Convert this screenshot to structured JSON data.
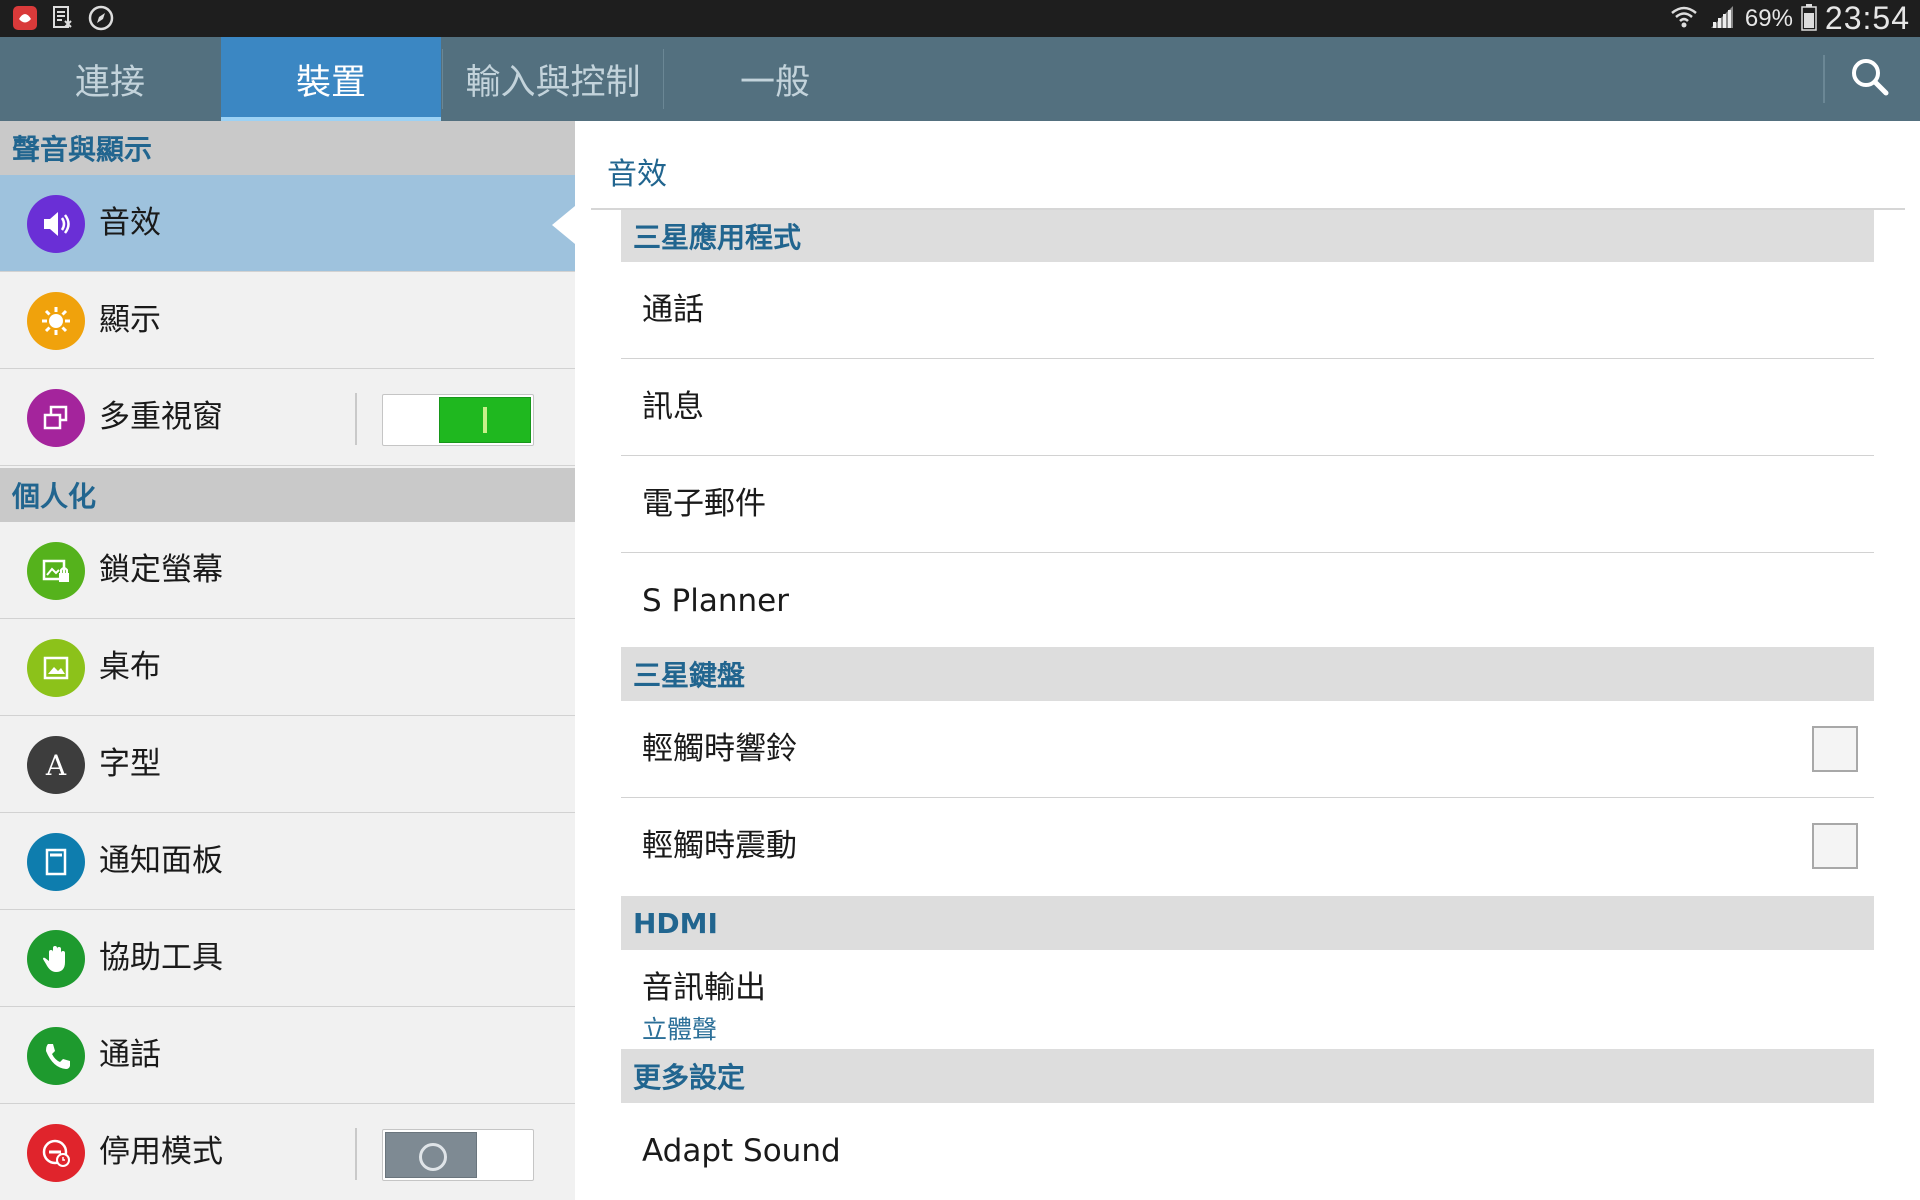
{
  "status_bar": {
    "left_icons": [
      "app-notification-icon",
      "document-icon",
      "compass-icon"
    ],
    "right_icons": [
      "wifi-icon",
      "signal-icon",
      "battery-icon"
    ],
    "battery": "69%",
    "time": "23:54"
  },
  "tabs": [
    {
      "label": "連接",
      "active": false
    },
    {
      "label": "裝置",
      "active": true
    },
    {
      "label": "輸入與控制",
      "active": false
    },
    {
      "label": "一般",
      "active": false
    }
  ],
  "search_icon": "search-icon",
  "left": {
    "sections": [
      {
        "header": "聲音與顯示",
        "items": [
          {
            "label": "音效",
            "icon": "speaker-icon",
            "color": "#6a2fd6",
            "selected": true
          },
          {
            "label": "顯示",
            "icon": "brightness-icon",
            "color": "#f0a20c"
          },
          {
            "label": "多重視窗",
            "icon": "multi-window-icon",
            "color": "#a4249c",
            "switch": "on"
          }
        ]
      },
      {
        "header": "個人化",
        "items": [
          {
            "label": "鎖定螢幕",
            "icon": "lock-screen-icon",
            "color": "#55b21c"
          },
          {
            "label": "桌布",
            "icon": "wallpaper-icon",
            "color": "#8cc21a"
          },
          {
            "label": "字型",
            "icon": "font-icon",
            "color": "#3d3d3d"
          },
          {
            "label": "通知面板",
            "icon": "notification-panel-icon",
            "color": "#0e7dae"
          },
          {
            "label": "協助工具",
            "icon": "hand-icon",
            "color": "#1e9a2e"
          },
          {
            "label": "通話",
            "icon": "phone-icon",
            "color": "#1e9a2e"
          },
          {
            "label": "停用模式",
            "icon": "blocking-mode-icon",
            "color": "#e0242c",
            "switch": "off"
          }
        ]
      }
    ]
  },
  "right": {
    "title": "音效",
    "sections": [
      {
        "header": "三星應用程式",
        "rows": [
          "通話",
          "訊息",
          "電子郵件",
          "S Planner"
        ]
      },
      {
        "header": "三星鍵盤",
        "rows": [
          {
            "label": "輕觸時響鈴",
            "checked": false
          },
          {
            "label": "輕觸時震動",
            "checked": false
          }
        ]
      },
      {
        "header": "HDMI",
        "rows": [
          {
            "label": "音訊輸出",
            "sub": "立體聲"
          }
        ]
      },
      {
        "header": "更多設定",
        "rows": [
          "Adapt Sound"
        ]
      }
    ]
  },
  "colors": {
    "tab_bar": "#53707f",
    "tab_active": "#3b87c3",
    "header_text": "#21658f",
    "selected_item": "#9ec2dd",
    "switch_on": "#1fb81f"
  }
}
